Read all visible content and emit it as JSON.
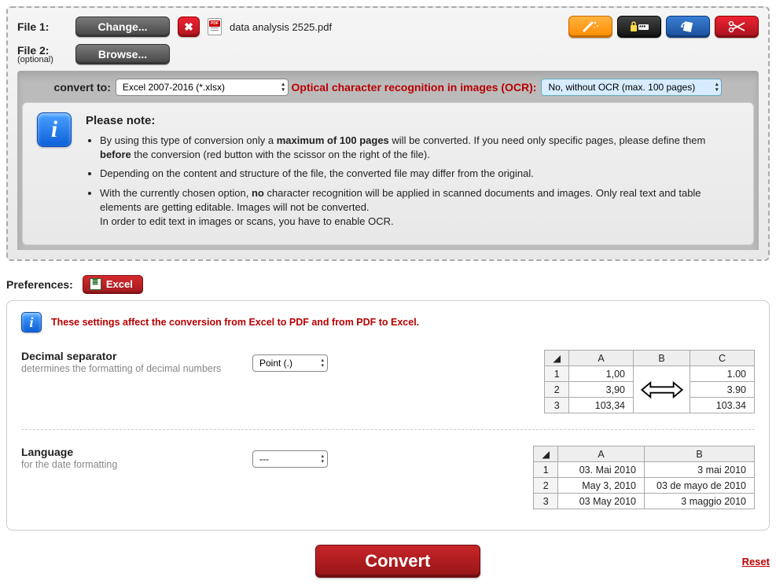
{
  "file1": {
    "label": "File 1:",
    "change": "Change...",
    "name": "data analysis 2525.pdf"
  },
  "file2": {
    "label": "File 2:",
    "optional": "(optional)",
    "browse": "Browse..."
  },
  "convert": {
    "label": "convert to:",
    "format": "Excel 2007-2016 (*.xlsx)",
    "ocr_label": "Optical character recognition in images (OCR):",
    "ocr_value": "No, without OCR (max. 100 pages)"
  },
  "notes": {
    "title": "Please note:",
    "b1_pre": "By using this type of conversion only a ",
    "b1_bold": "maximum of 100 pages",
    "b1_post": " will be converted. If you need only specific pages, please define them ",
    "b1_bold2": "before",
    "b1_post2": " the conversion (red button with the scissor on the right of the file).",
    "b2": "Depending on the content and structure of the file, the converted file may differ from the original.",
    "b3_pre": "With the currently chosen option, ",
    "b3_bold": "no",
    "b3_post": " character recognition will be applied in scanned documents and images. Only real text and table elements are getting editable. Images will not be converted.",
    "b3_line2": "In order to edit text in images or scans, you have to enable OCR."
  },
  "prefs": {
    "label": "Preferences:",
    "tab": "Excel",
    "banner": "These settings affect the conversion from Excel to PDF and from PDF to Excel.",
    "decimal": {
      "title": "Decimal separator",
      "desc": "determines the formatting of decimal numbers",
      "value": "Point (.)",
      "table": {
        "cols": [
          "A",
          "B",
          "C"
        ],
        "rows": [
          [
            "1",
            "1,00",
            "",
            "1.00"
          ],
          [
            "2",
            "3,90",
            "arrow",
            "3.90"
          ],
          [
            "3",
            "103,34",
            "",
            "103.34"
          ]
        ]
      }
    },
    "language": {
      "title": "Language",
      "desc": "for the date formatting",
      "value": "---",
      "table": {
        "cols": [
          "A",
          "B"
        ],
        "rows": [
          [
            "1",
            "03. Mai 2010",
            "3 mai 2010"
          ],
          [
            "2",
            "May 3, 2010",
            "03 de mayo de 2010"
          ],
          [
            "3",
            "03 May 2010",
            "3 maggio 2010"
          ]
        ]
      }
    }
  },
  "footer": {
    "convert": "Convert",
    "reset": "Reset"
  }
}
